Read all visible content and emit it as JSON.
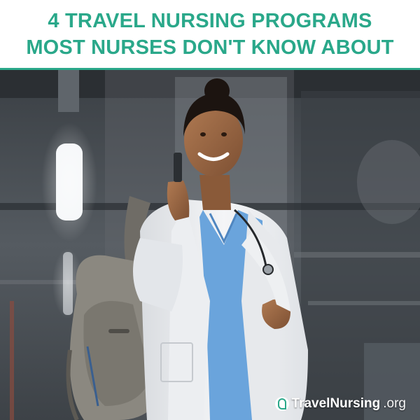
{
  "header": {
    "line1": "4 TRAVEL NURSING PROGRAMS",
    "line2": "MOST NURSES DON'T KNOW ABOUT"
  },
  "brand": {
    "name": "TravelNursing",
    "tld": ".org",
    "icon": "pin-logo-icon"
  },
  "colors": {
    "accent": "#2aa88a",
    "scrubs": "#6aa4dc",
    "coat": "#f1f2f4"
  }
}
